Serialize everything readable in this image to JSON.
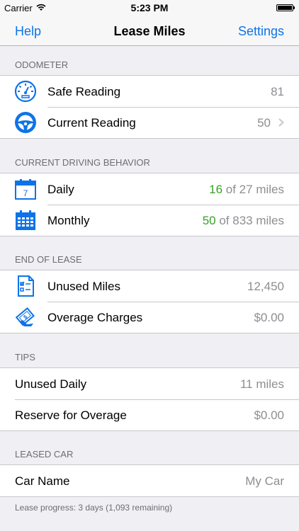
{
  "status_bar": {
    "carrier": "Carrier",
    "time": "5:23 PM"
  },
  "nav": {
    "left_label": "Help",
    "title": "Lease Miles",
    "right_label": "Settings"
  },
  "colors": {
    "accent": "#0e73e8",
    "positive": "#3a9f28",
    "secondary_text": "#8e8e93"
  },
  "sections": {
    "odometer": {
      "header": "ODOMETER",
      "rows": [
        {
          "icon": "speedometer-icon",
          "label": "Safe Reading",
          "value": "81"
        },
        {
          "icon": "steering-wheel-icon",
          "label": "Current Reading",
          "value": "50"
        }
      ]
    },
    "driving": {
      "header": "CURRENT DRIVING BEHAVIOR",
      "rows": [
        {
          "icon": "calendar-day-icon",
          "icon_text": "7",
          "label": "Daily",
          "value_highlight": "16",
          "value_rest": " of 27 miles"
        },
        {
          "icon": "calendar-month-icon",
          "label": "Monthly",
          "value_highlight": "50",
          "value_rest": " of 833 miles"
        }
      ]
    },
    "end_of_lease": {
      "header": "END OF LEASE",
      "rows": [
        {
          "icon": "checklist-document-icon",
          "label": "Unused Miles",
          "value": "12,450"
        },
        {
          "icon": "money-cash-icon",
          "label": "Overage Charges",
          "value": "$0.00"
        }
      ]
    },
    "tips": {
      "header": "TIPS",
      "rows": [
        {
          "label": "Unused Daily",
          "value": "11 miles"
        },
        {
          "label": "Reserve for Overage",
          "value": "$0.00"
        }
      ]
    },
    "leased_car": {
      "header": "LEASED CAR",
      "rows": [
        {
          "label": "Car Name",
          "placeholder": "My Car"
        }
      ],
      "footer": "Lease progress: 3 days (1,093 remaining)"
    }
  }
}
